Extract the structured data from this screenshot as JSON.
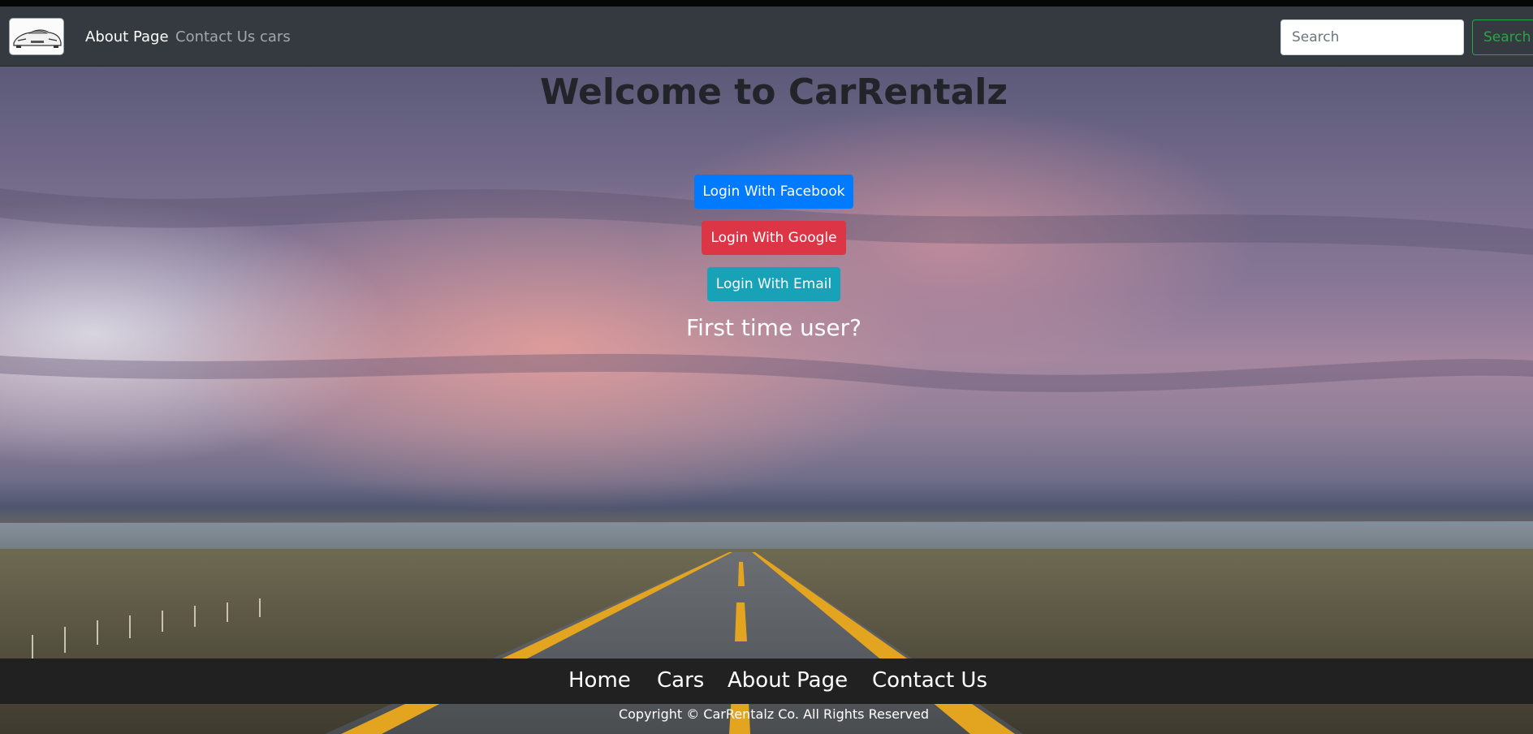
{
  "brand": {
    "logo_icon": "sports-car-logo-icon"
  },
  "navbar": {
    "links": [
      {
        "label": "About Page",
        "active": true
      },
      {
        "label": "Contact Us",
        "active": false
      },
      {
        "label": "cars",
        "active": false
      }
    ],
    "search": {
      "placeholder": "Search",
      "button_label": "Search"
    }
  },
  "hero": {
    "title": "Welcome to CarRentalz",
    "buttons": [
      {
        "label": "Login With Facebook",
        "color": "#007bff"
      },
      {
        "label": "Login With Google",
        "color": "#dc3545"
      },
      {
        "label": "Login With Email",
        "color": "#17a2b8"
      }
    ],
    "first_time_text": "First time user?"
  },
  "footer": {
    "links": [
      "Home",
      "Cars",
      "About Page",
      "Contact Us"
    ],
    "copyright": "Copyright © CarRentalz Co. All Rights Reserved"
  },
  "colors": {
    "navbar_bg": "#343a40",
    "footer_bg": "#212121",
    "search_button": "#28a745"
  }
}
